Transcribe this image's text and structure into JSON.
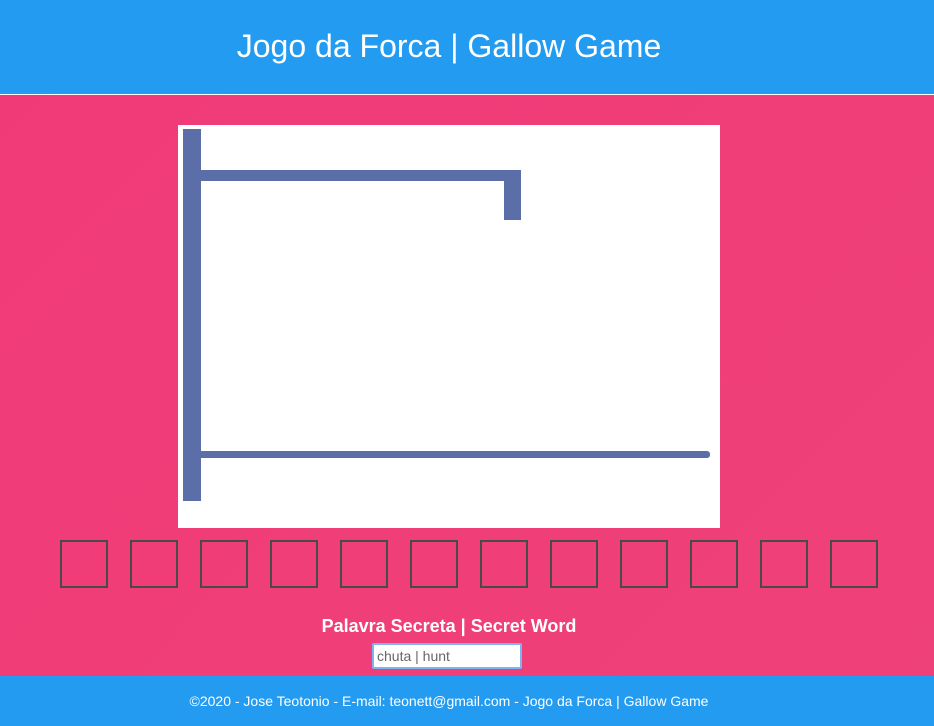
{
  "header": {
    "title": "Jogo da Forca | Gallow Game"
  },
  "game": {
    "stage": 0,
    "letters": [
      "",
      "",
      "",
      "",
      "",
      "",
      "",
      "",
      "",
      "",
      "",
      ""
    ],
    "secret_word_label": "Palavra Secreta | Secret Word",
    "guess_placeholder": "chuta | hunt",
    "guess_value": ""
  },
  "colors": {
    "header_bg": "#229bf1",
    "page_bg": "#f03a78",
    "gallows_stroke": "#5b6ea8",
    "box_border": "#4a4a4a"
  },
  "footer": {
    "text": "©2020 - Jose Teotonio - E-mail: teonett@gmail.com - Jogo da Forca | Gallow Game"
  }
}
